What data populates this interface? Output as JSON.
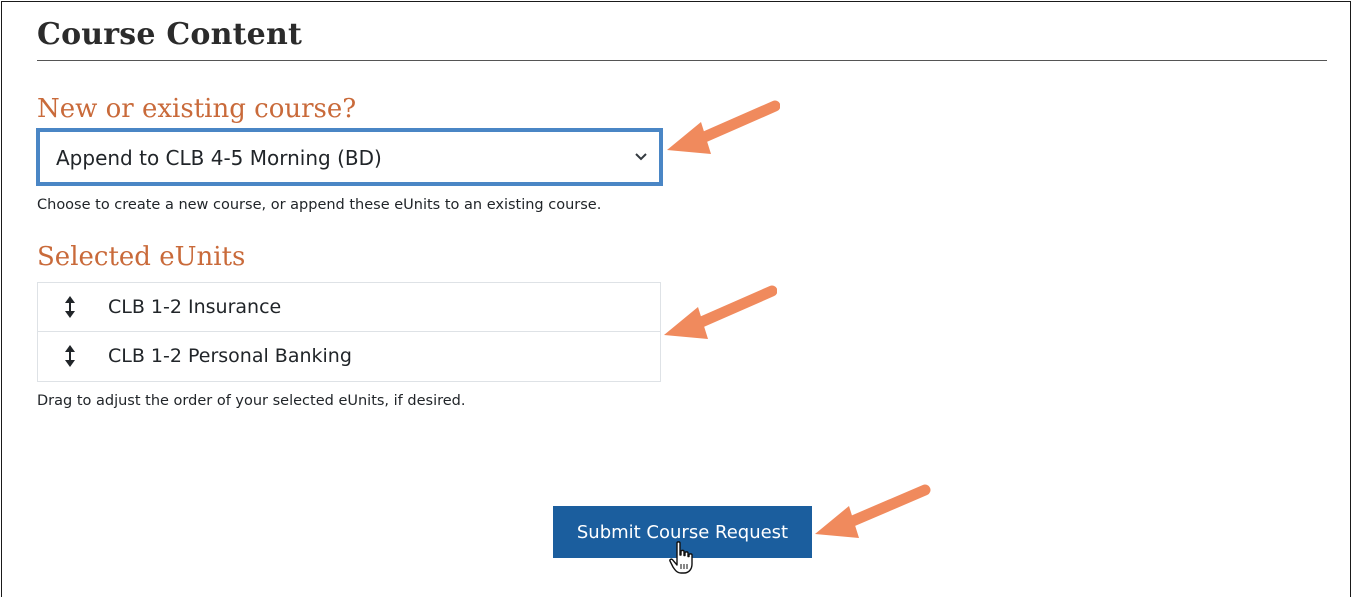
{
  "section": {
    "title": "Course Content"
  },
  "course_choice": {
    "label": "New or existing course?",
    "selected_value": "Append to CLB 4-5 Morning (BD)",
    "help": "Choose to create a new course, or append these eUnits to an existing course."
  },
  "selected_units": {
    "label": "Selected eUnits",
    "items": [
      {
        "label": "CLB 1-2 Insurance",
        "icon": "drag-vertical-arrows-icon"
      },
      {
        "label": "CLB 1-2 Personal Banking",
        "icon": "drag-vertical-arrows-icon"
      }
    ],
    "help": "Drag to adjust the order of your selected eUnits, if desired."
  },
  "submit": {
    "label": "Submit Course Request"
  },
  "colors": {
    "heading": "#2b2b2b",
    "accent_label": "#c96a3a",
    "select_border": "#4a86c5",
    "button_bg": "#1b5e9e",
    "annotation_arrow": "#f08a5d"
  },
  "annotations": {
    "arrow_icon": "annotation-arrow-icon",
    "cursor_icon": "hand-pointer-icon"
  }
}
